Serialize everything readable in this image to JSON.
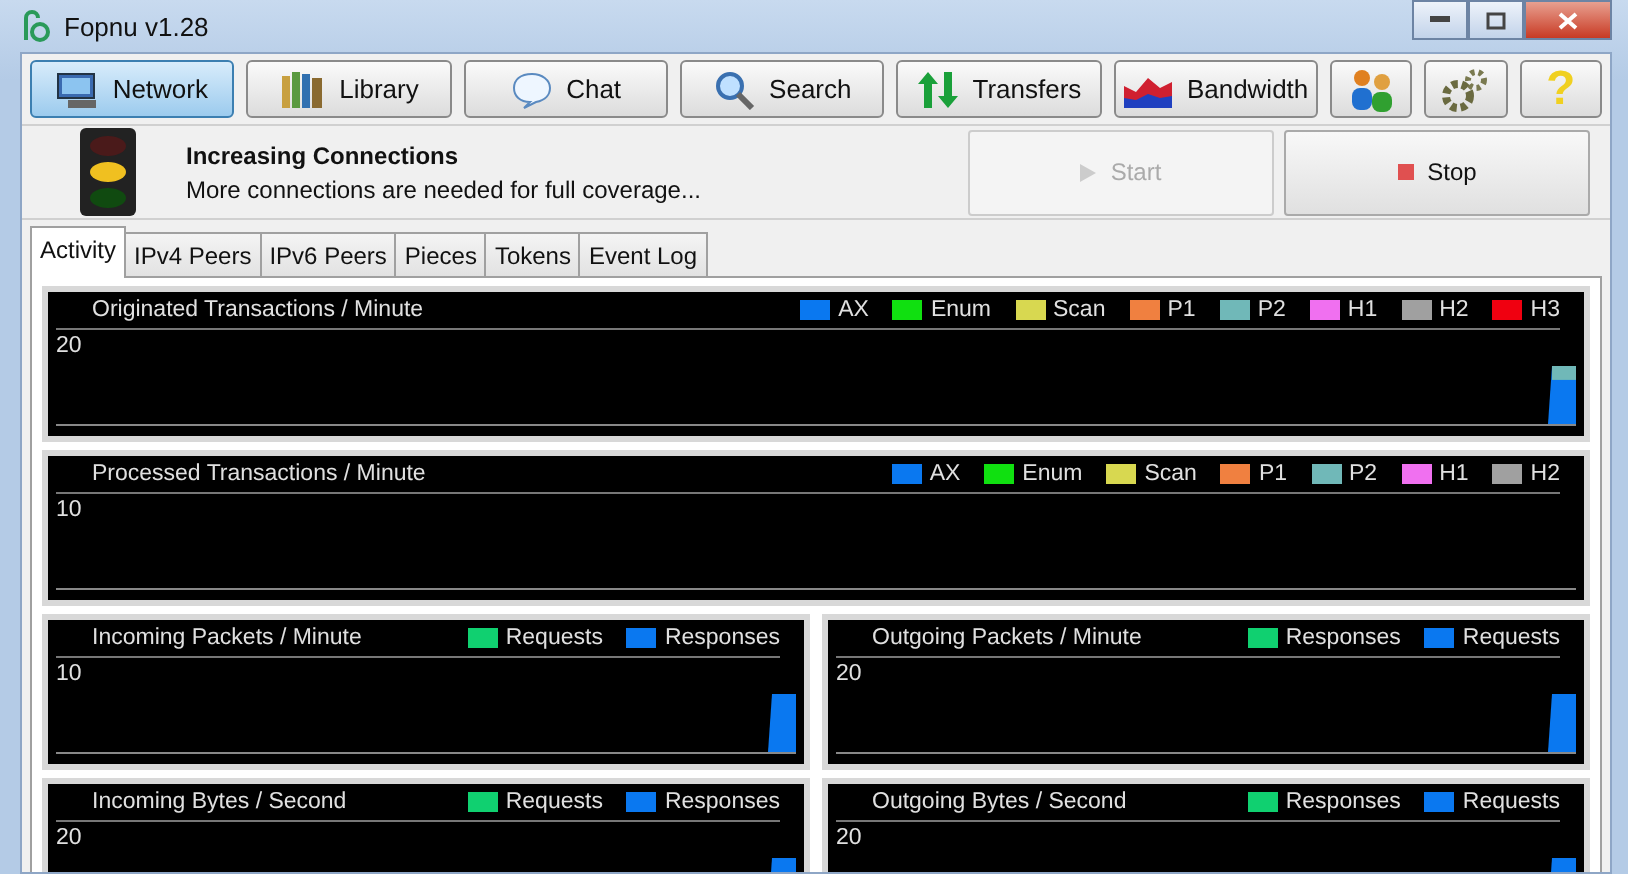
{
  "window": {
    "title": "Fopnu v1.28"
  },
  "toolbar": [
    {
      "label": "Network",
      "selected": true
    },
    {
      "label": "Library",
      "selected": false
    },
    {
      "label": "Chat",
      "selected": false
    },
    {
      "label": "Search",
      "selected": false
    },
    {
      "label": "Transfers",
      "selected": false
    },
    {
      "label": "Bandwidth",
      "selected": false
    }
  ],
  "help_button": {
    "label": "?"
  },
  "status": {
    "title": "Increasing Connections",
    "message": "More connections are needed for full coverage..."
  },
  "actions": [
    {
      "label": "Start",
      "kind": "start",
      "disabled": true
    },
    {
      "label": "Stop",
      "kind": "stop",
      "disabled": false
    }
  ],
  "tabs": [
    {
      "label": "Activity",
      "selected": true
    },
    {
      "label": "IPv4 Peers",
      "selected": false
    },
    {
      "label": "IPv6 Peers",
      "selected": false
    },
    {
      "label": "Pieces",
      "selected": false
    },
    {
      "label": "Tokens",
      "selected": false
    },
    {
      "label": "Event Log",
      "selected": false
    }
  ],
  "graphs": [
    {
      "title": "Originated Transactions / Minute",
      "scale": "20",
      "burst": true,
      "legend": [
        {
          "label": "AX",
          "color": "#0a78f0"
        },
        {
          "label": "Enum",
          "color": "#10e010"
        },
        {
          "label": "Scan",
          "color": "#d8d850"
        },
        {
          "label": "P1",
          "color": "#f08040"
        },
        {
          "label": "P2",
          "color": "#70b8b8"
        },
        {
          "label": "H1",
          "color": "#f070f0"
        },
        {
          "label": "H2",
          "color": "#a0a0a0"
        },
        {
          "label": "H3",
          "color": "#f00010"
        }
      ]
    },
    {
      "title": "Processed Transactions / Minute",
      "scale": "10",
      "burst": false,
      "legend": [
        {
          "label": "AX",
          "color": "#0a78f0"
        },
        {
          "label": "Enum",
          "color": "#10e010"
        },
        {
          "label": "Scan",
          "color": "#d8d850"
        },
        {
          "label": "P1",
          "color": "#f08040"
        },
        {
          "label": "P2",
          "color": "#70b8b8"
        },
        {
          "label": "H1",
          "color": "#f070f0"
        },
        {
          "label": "H2",
          "color": "#a0a0a0"
        }
      ]
    },
    {
      "title": "Incoming Packets / Minute",
      "scale": "10",
      "burst": true,
      "legend": [
        {
          "label": "Requests",
          "color": "#10d070"
        },
        {
          "label": "Responses",
          "color": "#0a78f0"
        }
      ]
    },
    {
      "title": "Outgoing Packets / Minute",
      "scale": "20",
      "burst": true,
      "legend": [
        {
          "label": "Responses",
          "color": "#10d070"
        },
        {
          "label": "Requests",
          "color": "#0a78f0"
        }
      ]
    },
    {
      "title": "Incoming Bytes / Second",
      "scale": "20",
      "burst": true,
      "legend": [
        {
          "label": "Requests",
          "color": "#10d070"
        },
        {
          "label": "Responses",
          "color": "#0a78f0"
        }
      ]
    },
    {
      "title": "Outgoing Bytes / Second",
      "scale": "20",
      "burst": true,
      "legend": [
        {
          "label": "Responses",
          "color": "#10d070"
        },
        {
          "label": "Requests",
          "color": "#0a78f0"
        }
      ]
    }
  ]
}
